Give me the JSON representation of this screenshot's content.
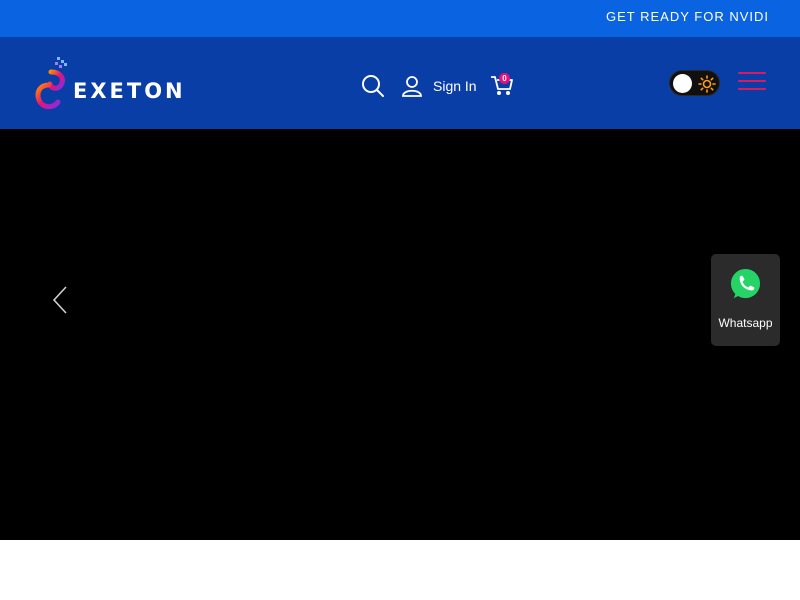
{
  "announcement": {
    "text": "GET READY FOR NVIDI"
  },
  "header": {
    "logo_text": "EXETON",
    "signin_label": "Sign In",
    "cart_count": "0",
    "icons": [
      "search-icon",
      "user-icon",
      "cart-icon",
      "sun-icon",
      "hamburger-menu-icon"
    ]
  },
  "hero": {
    "whatsapp_label": "Whatsapp"
  },
  "colors": {
    "topbar": "#0a63e0",
    "header": "#0a3ea7",
    "accent": "#e4127a",
    "hero": "#000000"
  }
}
